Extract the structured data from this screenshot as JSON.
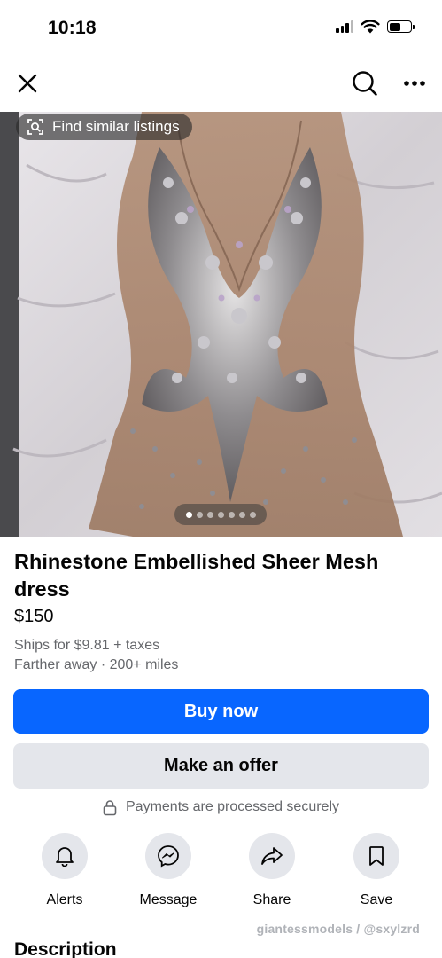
{
  "status_bar": {
    "time": "10:18"
  },
  "photo": {
    "find_similar_label": "Find similar listings",
    "image_count": 7,
    "current_image": 1
  },
  "listing": {
    "title": "Rhinestone Embellished Sheer Mesh dress",
    "price": "$150",
    "shipping": "Ships for $9.81 + taxes",
    "distance": "Farther away · 200+ miles"
  },
  "buttons": {
    "buy_now": "Buy now",
    "make_offer": "Make an offer"
  },
  "secure_notice": "Payments are processed securely",
  "actions": [
    {
      "label": "Alerts",
      "icon": "bell-icon"
    },
    {
      "label": "Message",
      "icon": "messenger-icon"
    },
    {
      "label": "Share",
      "icon": "share-icon"
    },
    {
      "label": "Save",
      "icon": "bookmark-icon"
    }
  ],
  "watermark": "giantessmodels / @sxylzrd",
  "description_heading": "Description",
  "colors": {
    "primary_blue": "#0866ff",
    "secondary_gray": "#e4e6eb",
    "muted_text": "#65676b"
  }
}
